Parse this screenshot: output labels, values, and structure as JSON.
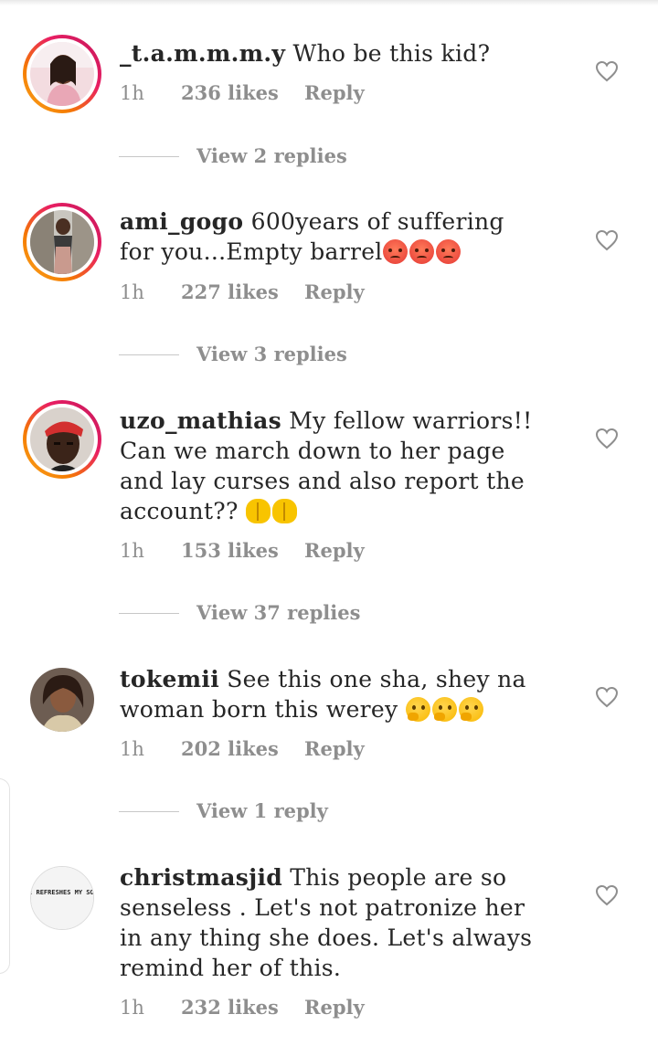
{
  "comments": [
    {
      "username": "_t.a.m.m.m.y",
      "text": "Who be this kid?",
      "emojis": [],
      "time": "1h",
      "likes": "236 likes",
      "reply": "Reply",
      "view_replies": "View 2 replies",
      "avatar_icon": "avatar-photo-icon",
      "story_ring": true
    },
    {
      "username": "ami_gogo",
      "text": "600years of suffering for you...Empty barrel",
      "emojis": [
        "angry-face-emoji",
        "angry-face-emoji",
        "angry-face-emoji"
      ],
      "time": "1h",
      "likes": "227 likes",
      "reply": "Reply",
      "view_replies": "View 3 replies",
      "avatar_icon": "avatar-photo-icon",
      "story_ring": true
    },
    {
      "username": "uzo_mathias",
      "text": "My fellow warriors!! Can we march down to her page and lay curses and also report the account??",
      "emojis": [
        "palms-up-emoji",
        "palms-up-emoji"
      ],
      "time": "1h",
      "likes": "153 likes",
      "reply": "Reply",
      "view_replies": "View 37 replies",
      "avatar_icon": "avatar-photo-icon",
      "story_ring": true
    },
    {
      "username": "tokemii",
      "text": "See this one sha, shey na woman born this werey",
      "emojis": [
        "thinking-face-emoji",
        "thinking-face-emoji",
        "thinking-face-emoji"
      ],
      "time": "1h",
      "likes": "202 likes",
      "reply": "Reply",
      "view_replies": "View 1 reply",
      "avatar_icon": "avatar-photo-icon",
      "story_ring": false
    },
    {
      "username": "christmasjid",
      "text": "This people are so senseless . Let's not patronize her in any thing she does. Let's always remind her of this.",
      "emojis": [],
      "time": "1h",
      "likes": "232 likes",
      "reply": "Reply",
      "avatar_icon": "avatar-photo-icon",
      "avatar_text": "HE REFRESHES MY SOUL",
      "story_ring": false
    }
  ],
  "colors": {
    "text": "#262626",
    "meta": "#8e8e8e",
    "divider": "#c7c7c7",
    "ring_start": "#f9a825",
    "ring_end": "#c2185b"
  }
}
